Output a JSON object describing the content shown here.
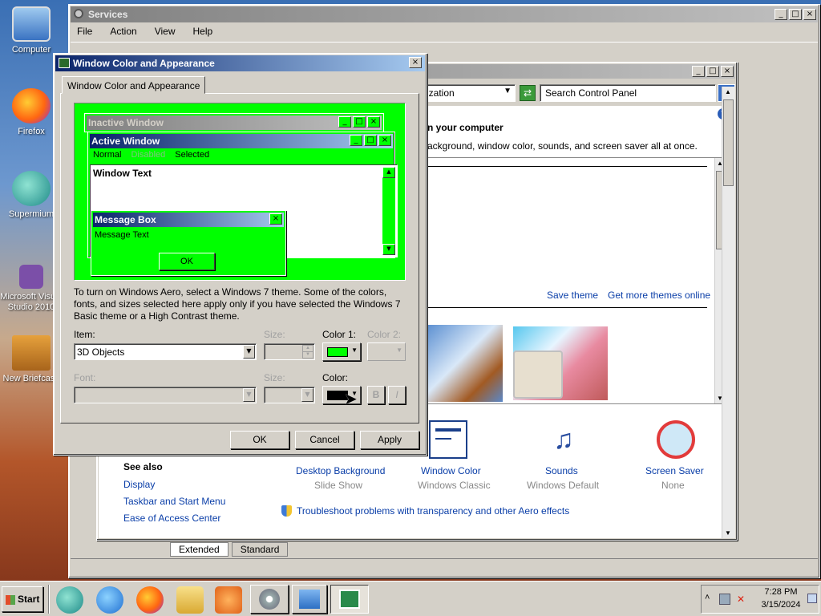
{
  "desktop": {
    "icons": [
      {
        "label": "Computer"
      },
      {
        "label": "Firefox"
      },
      {
        "label": "Supermium"
      },
      {
        "label": "Microsoft Visual Studio 2010"
      },
      {
        "label": "New Briefcase"
      }
    ]
  },
  "services": {
    "title": "Services",
    "menu": [
      "File",
      "Action",
      "View",
      "Help"
    ],
    "tabs": [
      "Extended",
      "Standard"
    ]
  },
  "personalization": {
    "address_text": "ization",
    "search_placeholder": "Search Control Panel",
    "heading": "n your computer",
    "subheading": "ackground, window color, sounds, and screen saver all at once.",
    "save_theme": "Save theme",
    "get_more_themes": "Get more themes online",
    "see_also": "See also",
    "see_also_links": [
      "Display",
      "Taskbar and Start Menu",
      "Ease of Access Center"
    ],
    "settings": [
      {
        "label": "Desktop Background",
        "value": "Slide Show"
      },
      {
        "label": "Window Color",
        "value": "Windows Classic"
      },
      {
        "label": "Sounds",
        "value": "Windows Default"
      },
      {
        "label": "Screen Saver",
        "value": "None"
      }
    ],
    "troubleshoot": "Troubleshoot problems with transparency and other Aero effects"
  },
  "dialog": {
    "title": "Window Color and Appearance",
    "tab": "Window Color and Appearance",
    "preview": {
      "inactive_title": "Inactive Window",
      "active_title": "Active Window",
      "menu_normal": "Normal",
      "menu_disabled": "Disabled",
      "menu_selected": "Selected",
      "window_text": "Window Text",
      "msgbox_title": "Message Box",
      "msgbox_text": "Message Text",
      "msgbox_ok": "OK"
    },
    "info": "To turn on Windows Aero, select a Windows 7 theme.  Some of the colors, fonts, and sizes selected here apply only if you have selected the Windows 7 Basic theme or a High Contrast theme.",
    "item_label": "Item:",
    "item_value": "3D Objects",
    "size_label": "Size:",
    "color1_label": "Color 1:",
    "color2_label": "Color 2:",
    "font_label": "Font:",
    "font_size_label": "Size:",
    "font_color_label": "Color:",
    "bold": "B",
    "italic": "I",
    "color1_swatch": "#00ff00",
    "font_color_swatch": "#000000",
    "ok": "OK",
    "cancel": "Cancel",
    "apply": "Apply"
  },
  "taskbar": {
    "start": "Start",
    "time": "7:28 PM",
    "date": "3/15/2024"
  },
  "colors": {
    "accent_green": "#00ff00",
    "title_active": "#0a246a",
    "title_inactive": "#808080"
  }
}
